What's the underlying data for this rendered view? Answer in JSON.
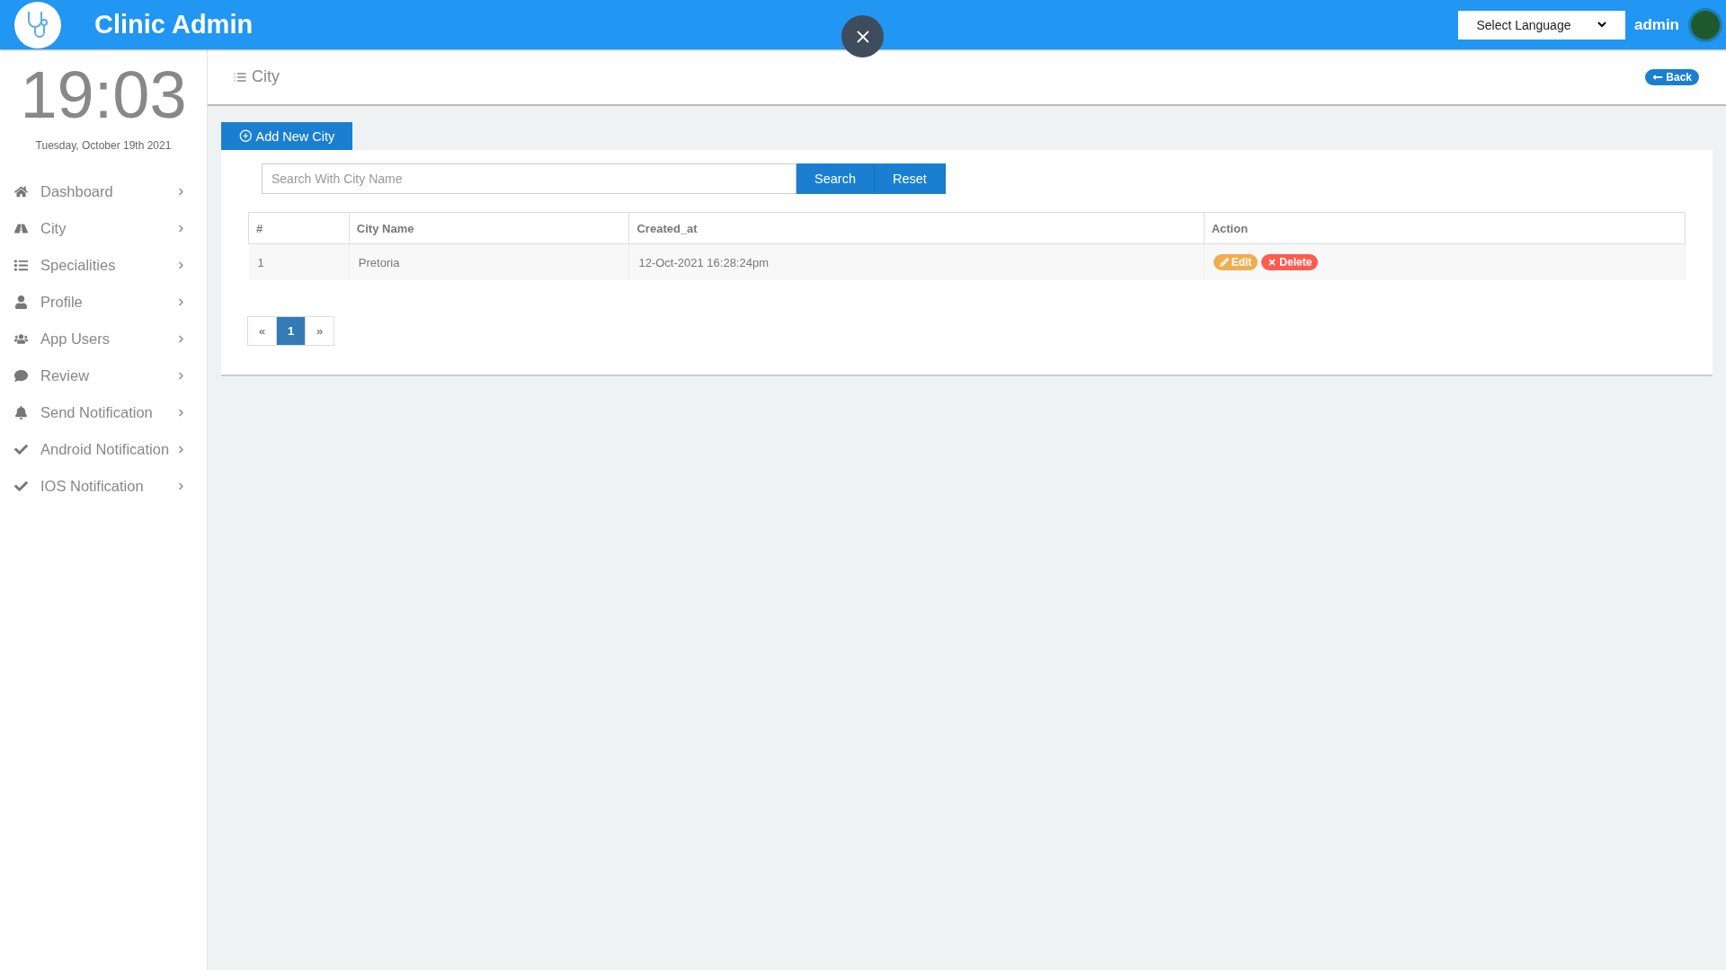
{
  "header": {
    "title": "Clinic Admin",
    "language_select": "Select Language",
    "user": "admin"
  },
  "sidebar": {
    "time": "19:03",
    "date": "Tuesday, October 19th 2021",
    "items": [
      {
        "label": "Dashboard"
      },
      {
        "label": "City"
      },
      {
        "label": "Specialities"
      },
      {
        "label": "Profile"
      },
      {
        "label": "App Users"
      },
      {
        "label": "Review"
      },
      {
        "label": "Send Notification"
      },
      {
        "label": "Android Notification"
      },
      {
        "label": "IOS Notification"
      }
    ]
  },
  "page": {
    "title": "City",
    "back": "Back",
    "add_button": "Add New City"
  },
  "search": {
    "placeholder": "Search With City Name",
    "buttons": [
      "Search",
      "Reset"
    ]
  },
  "table": {
    "columns": [
      "#",
      "City Name",
      "Created_at",
      "Action"
    ],
    "rows": [
      {
        "cells": [
          "1",
          "Pretoria",
          "12-Oct-2021 16:28:24pm"
        ],
        "actions": [
          "Edit",
          "Delete"
        ]
      }
    ]
  },
  "pagination": {
    "prev": "«",
    "next": "»",
    "pages": [
      {
        "label": "1",
        "selected": true
      }
    ]
  }
}
